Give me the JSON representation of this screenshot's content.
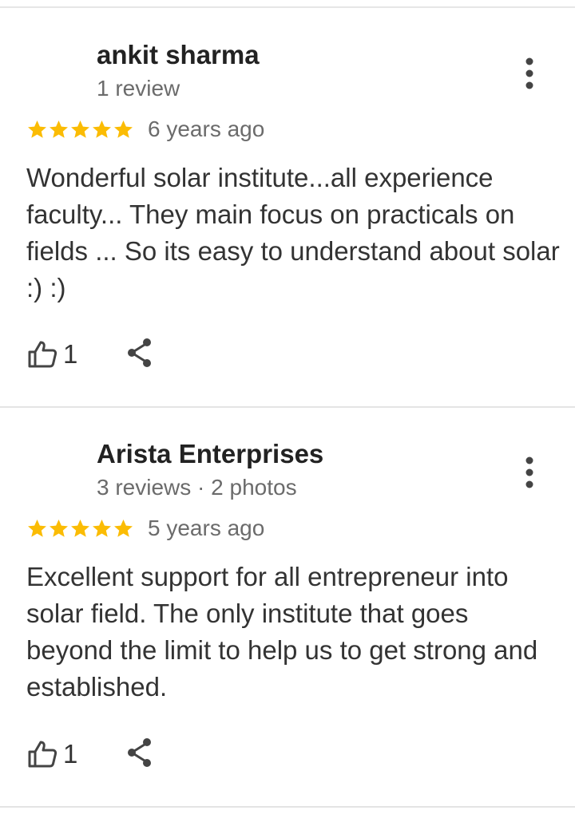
{
  "reviews": [
    {
      "name": "ankit sharma",
      "meta": "1 review",
      "rating": 5,
      "date": "6 years ago",
      "text": "Wonderful solar institute...all experience faculty... They main focus on practicals on fields ... So its easy to understand about solar :) :)",
      "likes": "1"
    },
    {
      "name": "Arista Enterprises",
      "meta": "3 reviews · 2 photos",
      "rating": 5,
      "date": "5 years ago",
      "text": "Excellent support for all entrepreneur into solar field. The only institute that goes beyond the limit to help us to get strong and established.",
      "likes": "1"
    }
  ],
  "colors": {
    "star": "#fbbc04",
    "name": "#222222",
    "meta": "#6b6b6b",
    "body": "#333333",
    "divider": "#e4e4e4"
  },
  "icons": {
    "more": "more-vert-icon",
    "like": "thumb-up-outline-icon",
    "share": "share-icon",
    "star": "star-icon"
  }
}
